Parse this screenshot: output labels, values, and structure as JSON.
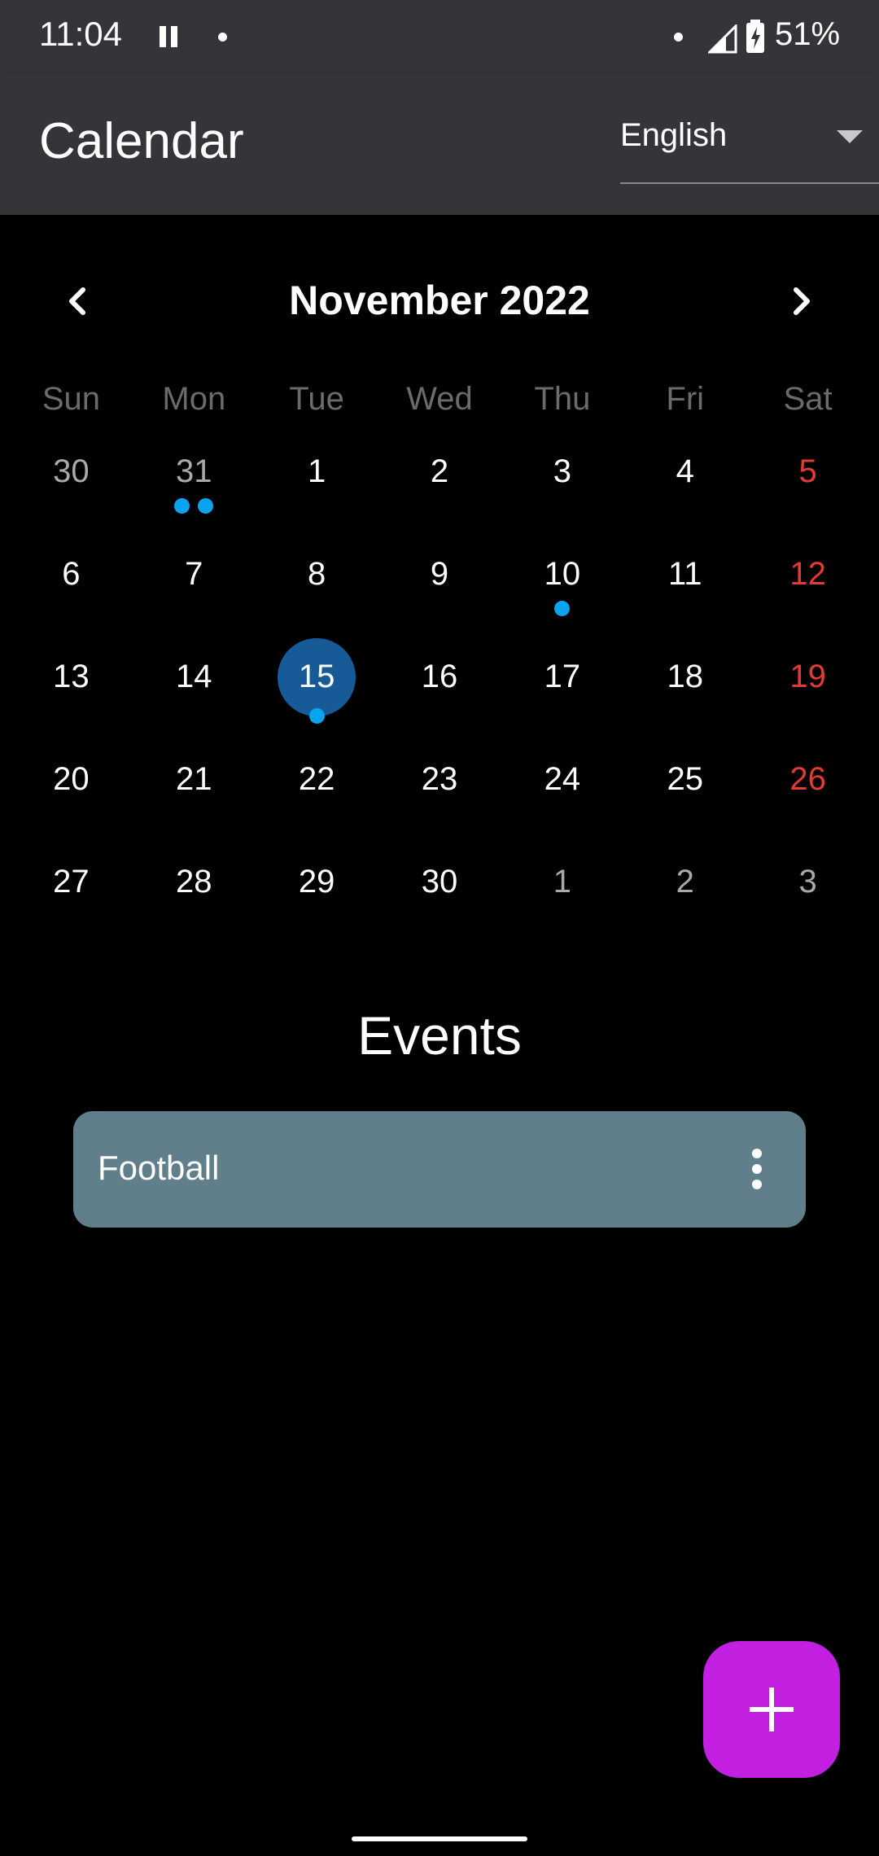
{
  "status_bar": {
    "time": "11:04",
    "battery": "51%"
  },
  "app_bar": {
    "title": "Calendar",
    "language": "English"
  },
  "calendar": {
    "month_title": "November 2022",
    "weekdays": [
      "Sun",
      "Mon",
      "Tue",
      "Wed",
      "Thu",
      "Fri",
      "Sat"
    ],
    "weeks": [
      [
        {
          "d": "30",
          "m": true
        },
        {
          "d": "31",
          "m": true,
          "dots": 2
        },
        {
          "d": "1"
        },
        {
          "d": "2"
        },
        {
          "d": "3"
        },
        {
          "d": "4"
        },
        {
          "d": "5",
          "w": true
        }
      ],
      [
        {
          "d": "6"
        },
        {
          "d": "7"
        },
        {
          "d": "8"
        },
        {
          "d": "9"
        },
        {
          "d": "10",
          "dots": 1
        },
        {
          "d": "11"
        },
        {
          "d": "12",
          "w": true
        }
      ],
      [
        {
          "d": "13"
        },
        {
          "d": "14"
        },
        {
          "d": "15",
          "sel": true,
          "dots": 1
        },
        {
          "d": "16"
        },
        {
          "d": "17"
        },
        {
          "d": "18"
        },
        {
          "d": "19",
          "w": true
        }
      ],
      [
        {
          "d": "20"
        },
        {
          "d": "21"
        },
        {
          "d": "22"
        },
        {
          "d": "23"
        },
        {
          "d": "24"
        },
        {
          "d": "25"
        },
        {
          "d": "26",
          "w": true
        }
      ],
      [
        {
          "d": "27"
        },
        {
          "d": "28"
        },
        {
          "d": "29"
        },
        {
          "d": "30"
        },
        {
          "d": "1",
          "m": true
        },
        {
          "d": "2",
          "m": true
        },
        {
          "d": "3",
          "m": true
        }
      ]
    ],
    "colors": {
      "weekend": "#e53935",
      "selected": "#165b98",
      "event_dot": "#0aa3f0"
    }
  },
  "events": {
    "title": "Events",
    "items": [
      {
        "name": "Football"
      }
    ]
  },
  "fab": {
    "icon": "plus-icon",
    "color": "#c31fe0"
  }
}
